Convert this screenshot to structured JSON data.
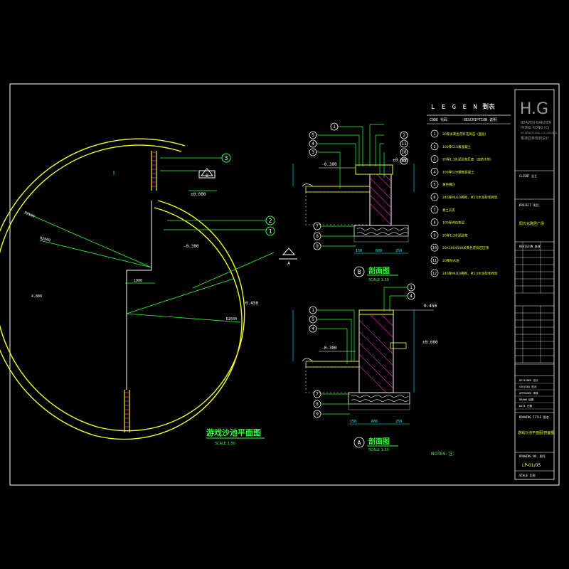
{
  "colors": {
    "background": "#000000",
    "frame": "#ffffff",
    "wall_yellow": "#f5ff2a",
    "leader_green": "#34ff3a",
    "fill_magenta": "#ff2bd5",
    "dim_cyan": "#00ffff",
    "grey_text": "#9a9a9a"
  },
  "plan": {
    "title": "游戏沙池平面图",
    "scale": "SCALE    1:50",
    "level_top": "±0.000",
    "level_center": "-0.300",
    "level_right": "0.450",
    "callout_b": "B",
    "callout_a": "A",
    "dim_left_upper": "R2500",
    "dim_left_lower": "R2600",
    "dim_left_mid": "4.800",
    "dim_right_lower": "R2500",
    "dim_stair": "1000"
  },
  "section_b": {
    "title": "剖面图",
    "scale": "SCALE    1:30",
    "label": "B",
    "level_left": "-0.300",
    "level_right": "±0.000",
    "dims": [
      "150",
      "600",
      "250"
    ],
    "callouts_left": [
      "1",
      "5",
      "4",
      "3",
      "7",
      "8",
      "9"
    ],
    "callouts_right": [
      "2",
      "11",
      "10",
      "12"
    ]
  },
  "section_a": {
    "title": "剖面图",
    "scale": "SCALE    1:30",
    "label": "A",
    "level_top": "0.450",
    "level_left": "-0.300",
    "level_right": "±0.000",
    "dims": [
      "150",
      "600",
      "250"
    ],
    "callouts_left": [
      "1",
      "5",
      "4",
      "3",
      "7",
      "8",
      "9"
    ],
    "callouts_top": [
      "1",
      "4"
    ]
  },
  "legend": {
    "title_en": "L E G E N D",
    "title_cn": "列表",
    "header_code": "CODE 代码",
    "header_desc": "DESCRIPTION 说明",
    "items": [
      {
        "code": "1",
        "text": "20厚米黄色荒料花岗石（面层）"
      },
      {
        "code": "2",
        "text": "100厚C15素混凝土"
      },
      {
        "code": "3",
        "text": "20厚1:3水泥砂浆打底（加防水剂）"
      },
      {
        "code": "4",
        "text": "100厚C20钢筋混凝土"
      },
      {
        "code": "5",
        "text": "黄色细沙"
      },
      {
        "code": "6",
        "text": "240厚MU10砖砌，M5.0水泥砂浆砌筑"
      },
      {
        "code": "7",
        "text": "素土夯实"
      },
      {
        "code": "8",
        "text": "100厚碎石垫层"
      },
      {
        "code": "9",
        "text": "20厚1:3水泥砂浆"
      },
      {
        "code": "10",
        "text": "20X100X500米黄色花岗石压顶"
      },
      {
        "code": "11",
        "text": "20厚防水层"
      },
      {
        "code": "12",
        "text": "240厚MU10砖砌，M5.0水泥砂浆砌筑"
      }
    ],
    "notes": "NOTES: 注："
  },
  "title_block": {
    "logo": "H.G",
    "company_en_1": "BEAVEN GARDEN",
    "company_en_2": "HONG KONG (C)",
    "company_en_3": "INTERNATIONAL CO.,LIMITED",
    "company_cn": "香港园林规划设计",
    "client_label": "CLIENT 业主",
    "project_label": "PROJECT 项目",
    "project_name": "阳光化雅居广场",
    "revision_label": "REVISION 修改",
    "sign_rows": [
      "DESIGNED 设计",
      "CHECKED 校对",
      "APPROVED 审核",
      "DRAWN 绘图",
      "DATE 日期"
    ],
    "drawing_title_label": "DRAWING TITLE 图名",
    "drawing_title": "游戏沙池平面图/剖面图",
    "drawing_no_label": "DRAWING NO. 图号",
    "drawing_no": "LP-01/05",
    "scale_label": "SCALE 比例"
  }
}
